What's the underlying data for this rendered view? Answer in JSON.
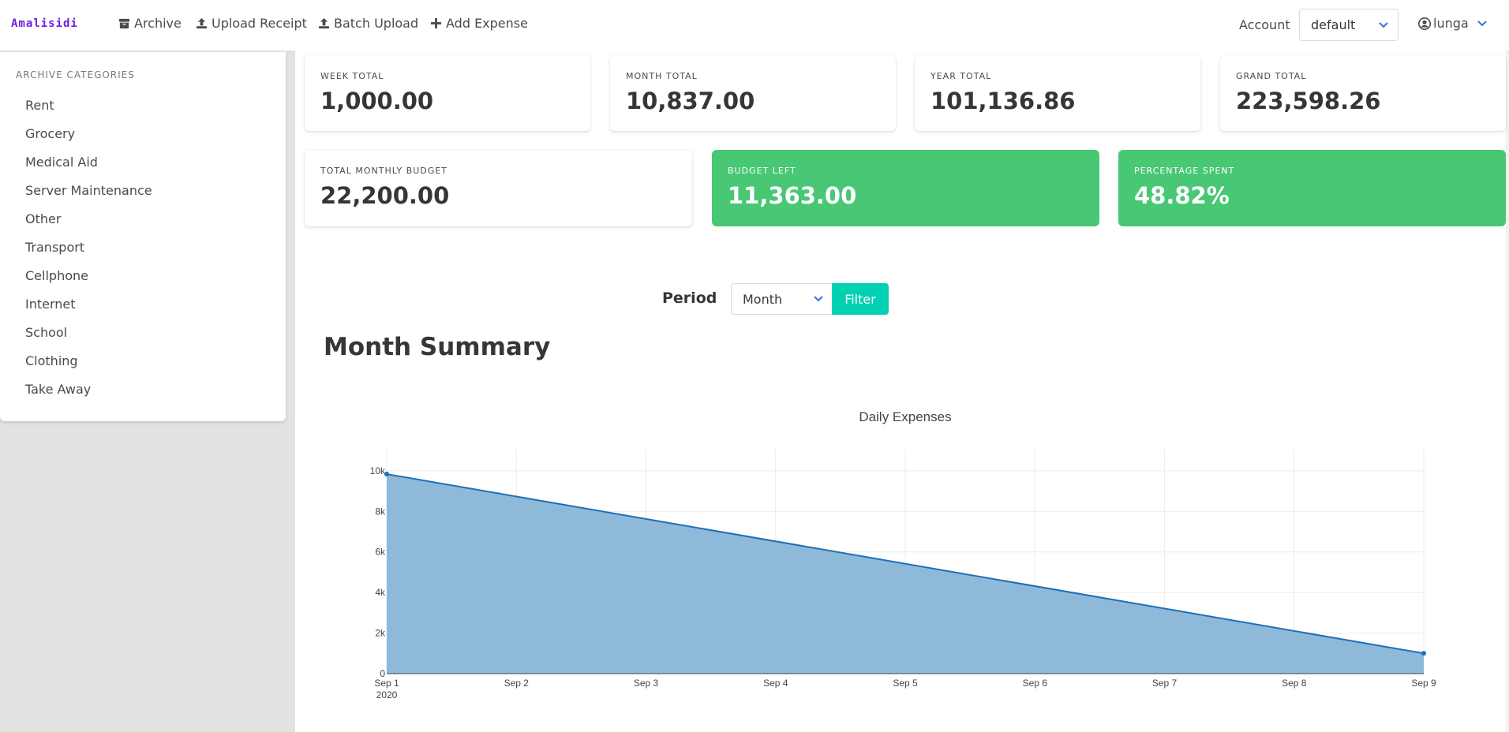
{
  "brand": "Amalisidi",
  "nav": {
    "archive": "Archive",
    "upload_receipt": "Upload Receipt",
    "batch_upload": "Batch Upload",
    "add_expense": "Add Expense",
    "account_label": "Account",
    "account_value": "default",
    "user": "lunga"
  },
  "sidebar": {
    "label": "ARCHIVE CATEGORIES",
    "items": [
      "Rent",
      "Grocery",
      "Medical Aid",
      "Server Maintenance",
      "Other",
      "Transport",
      "Cellphone",
      "Internet",
      "School",
      "Clothing",
      "Take Away"
    ]
  },
  "stats": {
    "week_total": {
      "label": "WEEK TOTAL",
      "value": "1,000.00"
    },
    "month_total": {
      "label": "MONTH TOTAL",
      "value": "10,837.00"
    },
    "year_total": {
      "label": "YEAR TOTAL",
      "value": "101,136.86"
    },
    "grand_total": {
      "label": "GRAND TOTAL",
      "value": "223,598.26"
    },
    "monthly_budget": {
      "label": "TOTAL MONTHLY BUDGET",
      "value": "22,200.00"
    },
    "budget_left": {
      "label": "BUDGET LEFT",
      "value": "11,363.00"
    },
    "percentage_spent": {
      "label": "PERCENTAGE SPENT",
      "value": "48.82%"
    }
  },
  "filter": {
    "label": "Period",
    "value": "Month",
    "button": "Filter"
  },
  "summary_title": "Month Summary",
  "colors": {
    "brand": "#6a1ee0",
    "green": "#48c774",
    "turquoise": "#00d1b2",
    "area_fill": "#8fb9d9",
    "line": "#1f6fb5",
    "link_blue": "#3273dc"
  },
  "chart_data": {
    "type": "area",
    "title": "Daily Expenses",
    "xlabel": "",
    "ylabel": "",
    "x": [
      "2020-09-01",
      "2020-09-09"
    ],
    "values": [
      9837,
      1000
    ],
    "x_ticks": [
      "Sep 1",
      "Sep 2",
      "Sep 3",
      "Sep 4",
      "Sep 5",
      "Sep 6",
      "Sep 7",
      "Sep 8",
      "Sep 9"
    ],
    "x_year_label": "2020",
    "y_ticks": [
      "0",
      "2k",
      "4k",
      "6k",
      "8k",
      "10k"
    ],
    "ylim": [
      0,
      10500
    ],
    "grid": true,
    "legend": "none"
  }
}
